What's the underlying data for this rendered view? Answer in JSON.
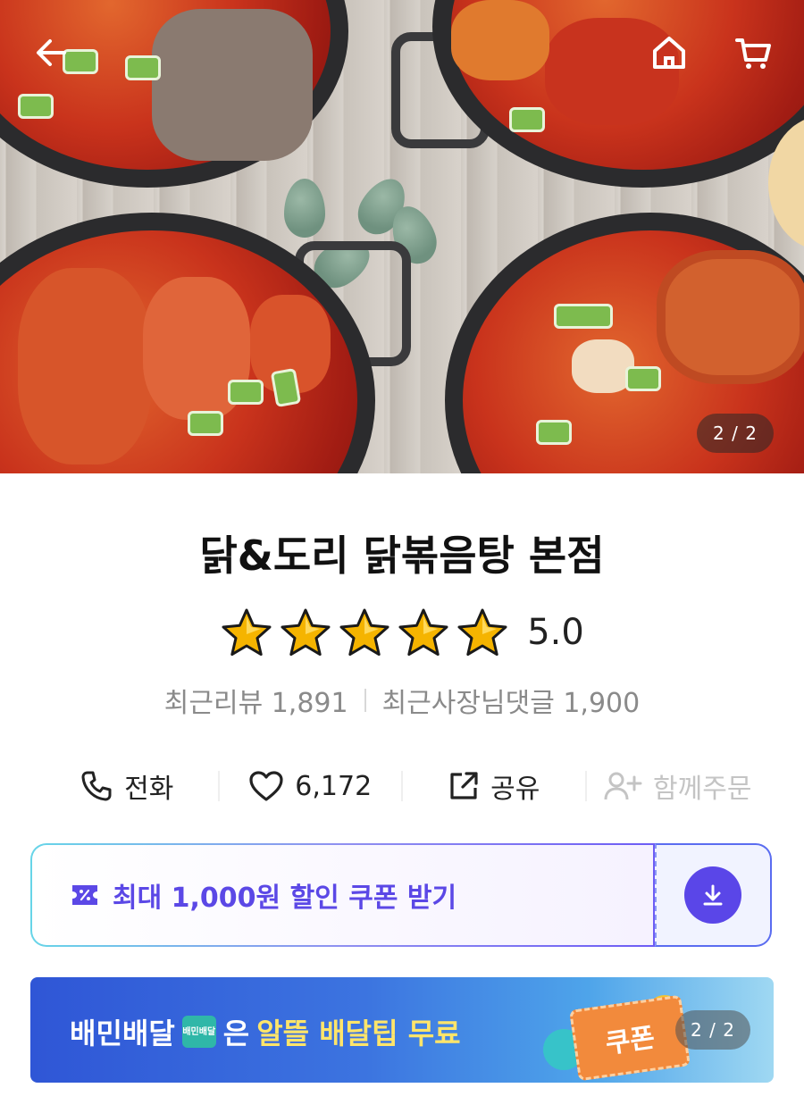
{
  "hero": {
    "image_counter": "2 / 2"
  },
  "store": {
    "name": "닭&도리 닭볶음탕 본점",
    "rating_value": "5.0",
    "stars": 5,
    "recent_reviews": "최근리뷰 1,891",
    "recent_owner_replies": "최근사장님댓글 1,900"
  },
  "actions": {
    "call": "전화",
    "likes": "6,172",
    "share": "공유",
    "group_order": "함께주문"
  },
  "coupon": {
    "label": "최대 1,000원 할인 쿠폰 받기"
  },
  "banner": {
    "brand": "배민배달",
    "badge": "배민배달",
    "middle": "은",
    "highlight": "알뜰 배달팁 무료",
    "ticket": "쿠폰",
    "counter": "2 / 2"
  },
  "colors": {
    "accent": "#5a46e8",
    "star": "#f5b400"
  }
}
